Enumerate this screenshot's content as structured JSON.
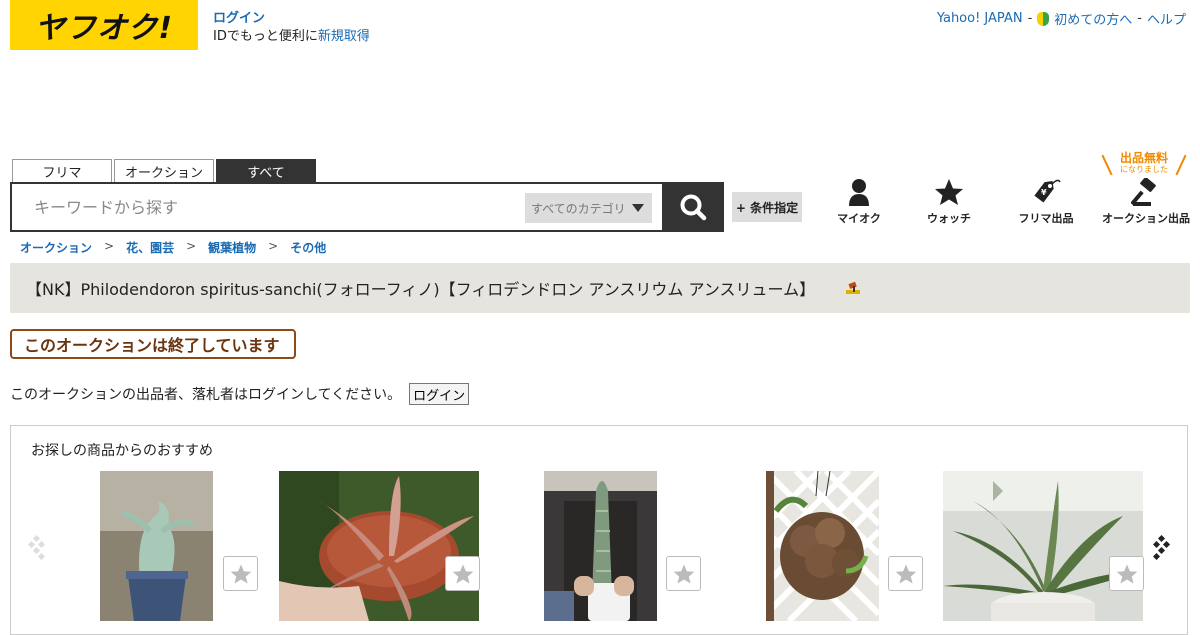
{
  "header": {
    "logo_text": "ヤフオク!",
    "login_link": "ログイン",
    "login_sub_prefix": "IDでもっと便利に",
    "signup_link": "新規取得",
    "links": {
      "yahoo_japan": "Yahoo! JAPAN",
      "beginners": "初めての方へ",
      "help": "ヘルプ",
      "sep": "-"
    }
  },
  "search": {
    "tabs": [
      "フリマ",
      "オークション",
      "すべて"
    ],
    "active_tab": "すべて",
    "placeholder": "キーワードから探す",
    "category_selected": "すべてのカテゴリ",
    "condition_button": "+ 条件指定"
  },
  "nav": {
    "items": [
      "マイオク",
      "ウォッチ",
      "フリマ出品",
      "オークション出品"
    ],
    "free_badge_main": "出品無料",
    "free_badge_sub": "になりました"
  },
  "breadcrumb": {
    "items": [
      "オークション",
      "花、園芸",
      "観葉植物",
      "その他"
    ],
    "sep": ">"
  },
  "item": {
    "title": "【NK】Philodendoron spiritus-sanchi(フォローフィノ)【フィロデンドロン アンスリウム アンスリューム】",
    "ended_notice": "このオークションは終了しています",
    "login_note": "このオークションの出品者、落札者はログインしてください。",
    "login_button": "ログイン"
  },
  "recommend": {
    "heading": "お探しの商品からのおすすめ",
    "products": [
      {
        "image": "succulent-pot-blue"
      },
      {
        "image": "pink-foliage-pot"
      },
      {
        "image": "sansevieria-cylinder"
      },
      {
        "image": "hanging-bulb-plant"
      },
      {
        "image": "sansevieria-large-pot"
      }
    ]
  },
  "colors": {
    "brand_yellow": "#ffd400",
    "link_blue": "#1a6bb3",
    "dark": "#333333",
    "title_band": "#e5e4de",
    "ended_border": "#8b4a1a",
    "free_orange": "#f08a00"
  }
}
